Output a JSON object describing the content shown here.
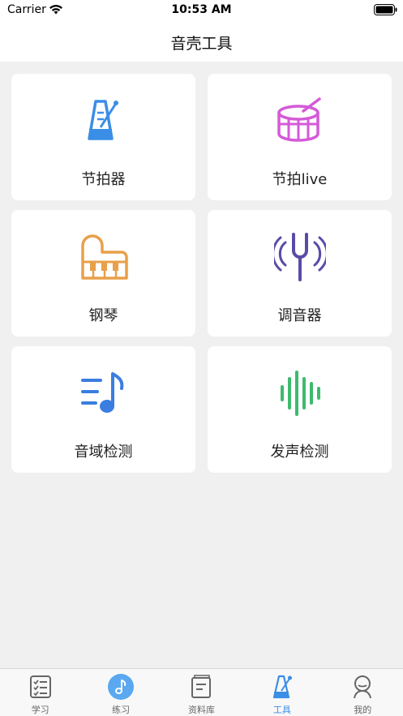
{
  "status_bar": {
    "carrier": "Carrier",
    "time": "10:53 AM"
  },
  "nav": {
    "title": "音壳工具"
  },
  "tools": [
    {
      "label": "节拍器",
      "icon": "metronome-icon",
      "color": "#3a8ee6"
    },
    {
      "label": "节拍live",
      "icon": "drum-icon",
      "color": "#d45ad8"
    },
    {
      "label": "钢琴",
      "icon": "piano-icon",
      "color": "#e8a04a"
    },
    {
      "label": "调音器",
      "icon": "tuning-fork-icon",
      "color": "#5b4ba8"
    },
    {
      "label": "音域检测",
      "icon": "music-list-icon",
      "color": "#3a7ee0"
    },
    {
      "label": "发声检测",
      "icon": "sound-wave-icon",
      "color": "#3dbb6e"
    }
  ],
  "tab_bar": {
    "items": [
      {
        "label": "学习",
        "icon": "checklist-icon"
      },
      {
        "label": "练习",
        "icon": "music-note-icon"
      },
      {
        "label": "资料库",
        "icon": "book-icon"
      },
      {
        "label": "工具",
        "icon": "metronome-icon",
        "active": true
      },
      {
        "label": "我的",
        "icon": "user-icon"
      }
    ],
    "active_color": "#3a8ee6"
  }
}
